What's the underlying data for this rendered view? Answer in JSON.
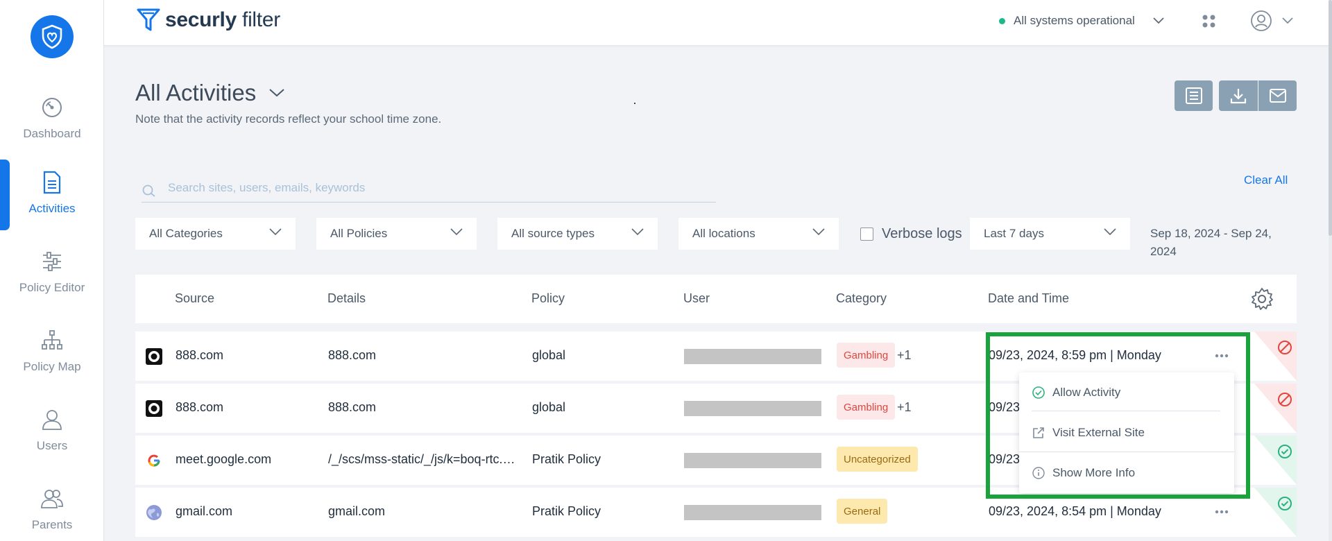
{
  "brand": {
    "prefix": "securly",
    "suffix": "filter"
  },
  "status": {
    "text": "All systems operational"
  },
  "sidebar": {
    "items": [
      {
        "label": "Dashboard",
        "icon": "gauge-icon"
      },
      {
        "label": "Activities",
        "icon": "document-icon"
      },
      {
        "label": "Policy Editor",
        "icon": "sliders-icon"
      },
      {
        "label": "Policy Map",
        "icon": "sitemap-icon"
      },
      {
        "label": "Users",
        "icon": "user-icon"
      },
      {
        "label": "Parents",
        "icon": "parents-icon"
      }
    ]
  },
  "header": {
    "title": "All Activities",
    "subtitle": "Note that the activity records reflect your school time zone."
  },
  "search": {
    "placeholder": "Search sites, users, emails, keywords",
    "value": ""
  },
  "clear_all": "Clear All",
  "filters": {
    "categories": "All Categories",
    "policies": "All Policies",
    "source_types": "All source types",
    "locations": "All locations",
    "verbose_label": "Verbose logs",
    "time_range": "Last 7 days",
    "date_range_line1": "Sep 18, 2024 -  Sep 24,",
    "date_range_line2": "2024"
  },
  "table": {
    "columns": [
      "Source",
      "Details",
      "Policy",
      "User",
      "Category",
      "Date and Time"
    ],
    "rows": [
      {
        "source": "888.com",
        "details": "888.com",
        "policy": "global",
        "category": "Gambling",
        "extra": "+1",
        "datetime": "09/23, 2024, 8:59 pm | Monday",
        "status": "blocked"
      },
      {
        "source": "888.com",
        "details": "888.com",
        "policy": "global",
        "category": "Gambling",
        "extra": "+1",
        "datetime": "09/23",
        "status": "blocked"
      },
      {
        "source": "meet.google.com",
        "details": "/_/scs/mss-static/_/js/k=boq-rtc.…",
        "policy": "Pratik Policy",
        "category": "Uncategorized",
        "extra": "",
        "datetime": "09/23",
        "status": "allowed"
      },
      {
        "source": "gmail.com",
        "details": "gmail.com",
        "policy": "Pratik Policy",
        "category": "General",
        "extra": "",
        "datetime": "09/23, 2024, 8:54 pm | Monday",
        "status": "allowed"
      }
    ]
  },
  "row_menu": {
    "items": [
      {
        "label": "Allow Activity",
        "icon": "check-circle-icon"
      },
      {
        "label": "Visit External Site",
        "icon": "external-link-icon"
      },
      {
        "label": "Show More Info",
        "icon": "info-icon"
      }
    ]
  },
  "colors": {
    "accent": "#1476e8",
    "highlight": "#1aa23c",
    "blocked": "#e0463d",
    "allowed": "#2bb07f",
    "header_button": "#8aa0b3"
  }
}
